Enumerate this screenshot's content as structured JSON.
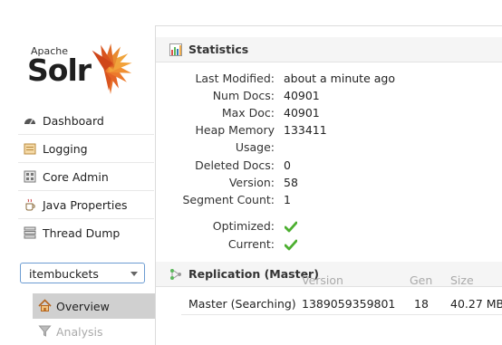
{
  "logo": {
    "small_text": "Apache",
    "big_text": "Solr"
  },
  "nav": [
    {
      "label": "Dashboard",
      "icon": "dashboard-icon"
    },
    {
      "label": "Logging",
      "icon": "logging-icon"
    },
    {
      "label": "Core Admin",
      "icon": "core-admin-icon"
    },
    {
      "label": "Java Properties",
      "icon": "java-properties-icon"
    },
    {
      "label": "Thread Dump",
      "icon": "thread-dump-icon"
    }
  ],
  "core_selector": {
    "value": "itembuckets"
  },
  "core_menu": [
    {
      "label": "Overview",
      "icon": "home-icon",
      "active": true
    },
    {
      "label": "Analysis",
      "icon": "filter-icon",
      "active": false
    }
  ],
  "statistics": {
    "title": "Statistics",
    "rows": [
      {
        "label": "Last Modified:",
        "value": "about a minute ago"
      },
      {
        "label": "Num Docs:",
        "value": "40901"
      },
      {
        "label": "Max Doc:",
        "value": "40901"
      },
      {
        "label": "Heap Memory",
        "value": "133411"
      },
      {
        "label": "Usage:",
        "value": ""
      },
      {
        "label": "Deleted Docs:",
        "value": "0"
      },
      {
        "label": "Version:",
        "value": "58"
      },
      {
        "label": "Segment Count:",
        "value": "1"
      }
    ],
    "flags": [
      {
        "label": "Optimized:",
        "state": "check"
      },
      {
        "label": "Current:",
        "state": "check"
      }
    ]
  },
  "replication": {
    "title": "Replication (Master)",
    "columns": [
      "Version",
      "Gen",
      "Size"
    ],
    "row": {
      "name": "Master (Searching)",
      "version": "1389059359801",
      "gen": "18",
      "size": "40.27 MB"
    }
  },
  "colors": {
    "accent_border": "#6c9cd2",
    "check_green": "#4caf30",
    "logo_orange": "#e8702a"
  }
}
